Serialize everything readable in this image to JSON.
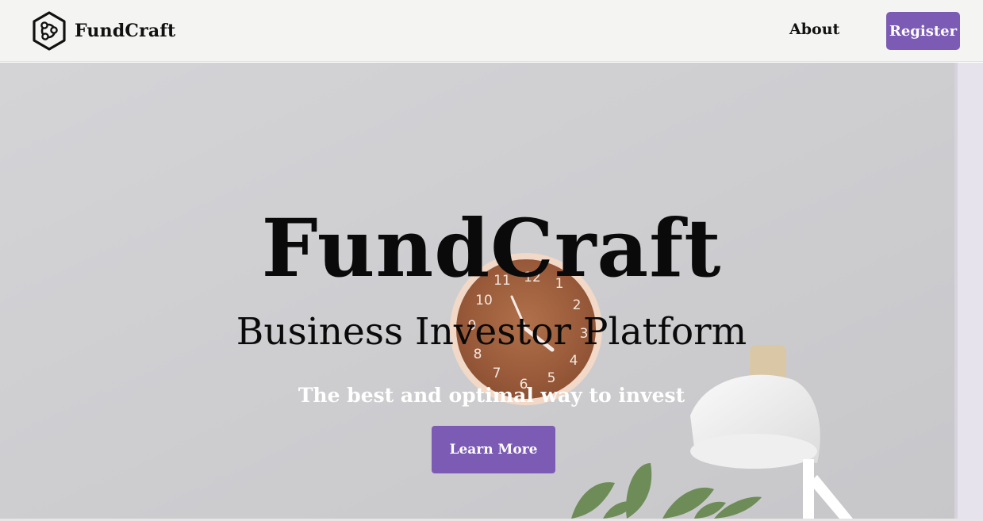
{
  "navbar": {
    "brand_name": "FundCraft",
    "brand_icon": "hexagon-network-logo-icon",
    "about_label": "About",
    "register_label": "Register"
  },
  "hero": {
    "title": "FundCraft",
    "subtitle": "Business Investor Platform",
    "tagline": "The best and optimal way to invest",
    "cta_label": "Learn More",
    "background_image": "wall-clock-desk-lamp-plant-photo"
  },
  "colors": {
    "accent": "#7c5bb5",
    "navbar_bg": "#f4f4f2",
    "text_dark": "#0a0a0a"
  }
}
